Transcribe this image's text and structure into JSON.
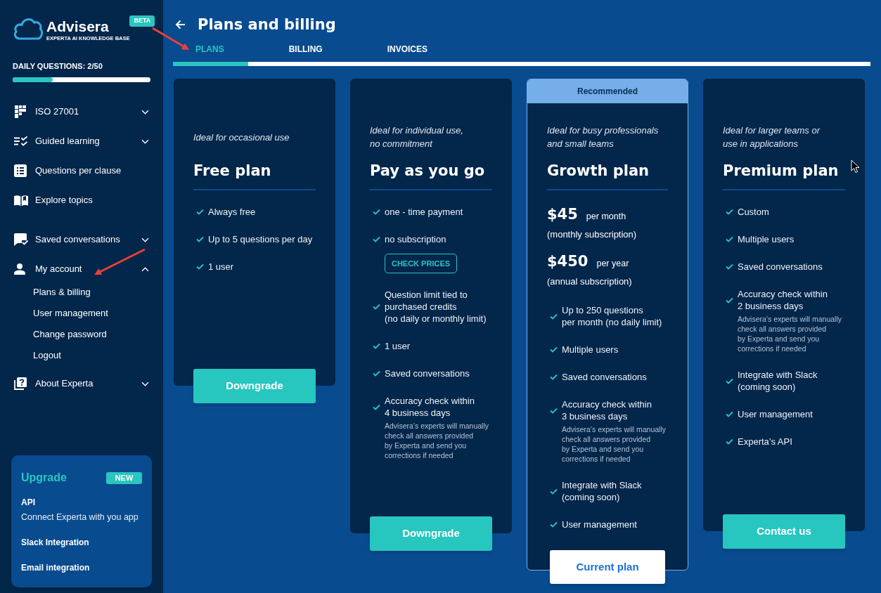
{
  "sidebar": {
    "brand": {
      "name": "Advisera",
      "subtitle": "EXPERTA AI KNOWLEDGE BASE",
      "badge": "BETA"
    },
    "daily_questions": {
      "label": "DAILY QUESTIONS: 2/50",
      "level": 0.29
    },
    "nav_groups": [
      {
        "items": [
          {
            "label": "ISO 27001",
            "expanded": false
          },
          {
            "label": "Guided learning",
            "expanded": false
          },
          {
            "label": "Questions per clause"
          },
          {
            "label": "Explore topics"
          }
        ]
      },
      {
        "items": [
          {
            "label": "Saved conversations",
            "expanded": false
          },
          {
            "label": "My account",
            "expanded": true,
            "children": [
              {
                "label": "Plans & billing"
              },
              {
                "label": "User management"
              },
              {
                "label": "Change password"
              },
              {
                "label": "Logout"
              }
            ]
          },
          {
            "label": "About Experta",
            "expanded": false
          }
        ]
      }
    ],
    "upgrade": {
      "title": "Upgrade",
      "badge": "NEW",
      "items": [
        {
          "title": "API",
          "description": "Connect Experta with you app"
        },
        {
          "title": "Slack Integration"
        },
        {
          "title": "Email integration"
        }
      ]
    }
  },
  "header": {
    "title": "Plans and billing",
    "tabs": [
      {
        "label": "PLANS",
        "selected": true
      },
      {
        "label": "BILLING",
        "selected": false
      },
      {
        "label": "INVOICES",
        "selected": false
      }
    ]
  },
  "plans": [
    {
      "tagline": "Ideal for occasional use",
      "name": "Free plan",
      "features": [
        {
          "text": "Always free"
        },
        {
          "text": "Up to 5 questions per day"
        },
        {
          "text": "1 user"
        }
      ],
      "button": {
        "label": "Downgrade",
        "kind": "primary"
      }
    },
    {
      "tagline": "Ideal for individual use,\nno commitment",
      "name": "Pay as you go",
      "features": [
        {
          "text": "one - time payment"
        },
        {
          "text": "no subscription",
          "button": "CHECK PRICES"
        },
        {
          "text": "Question limit tied to\npurchased credits\n(no daily or monthly limit)"
        },
        {
          "text": "1 user"
        },
        {
          "text": "Saved conversations"
        },
        {
          "text": "Accuracy check within\n4 business days",
          "note": "Advisera’s experts will manually\ncheck all answers provided\nby Experta and send you\ncorrections if needed"
        }
      ],
      "button": {
        "label": "Downgrade",
        "kind": "primary"
      }
    },
    {
      "badge": "Recommended",
      "tagline": "Ideal for busy professionals\nand small teams",
      "name": "Growth plan",
      "prices": [
        {
          "amount": "$45",
          "period": "per month",
          "note": "(monthly subscription)"
        },
        {
          "amount": "$450",
          "period": "per year",
          "note": "(annual subscription)"
        }
      ],
      "features": [
        {
          "text": "Up to 250 questions\nper month (no daily limit)"
        },
        {
          "text": "Multiple users"
        },
        {
          "text": "Saved conversations"
        },
        {
          "text": "Accuracy check within\n3 business days",
          "note": "Advisera’s experts will manually\ncheck all answers provided\nby Experta and send you\ncorrections if needed"
        },
        {
          "text": "Integrate with Slack\n(coming soon)"
        },
        {
          "text": "User management"
        }
      ],
      "button": {
        "label": "Current plan",
        "kind": "current"
      }
    },
    {
      "tagline": "Ideal for larger teams or\nuse in applications",
      "name": "Premium plan",
      "features": [
        {
          "text": "Custom"
        },
        {
          "text": "Multiple users"
        },
        {
          "text": "Saved conversations"
        },
        {
          "text": "Accuracy check within\n2 business days",
          "note": "Advisera’s experts will manually\ncheck all answers provided\nby Experta and send you\ncorrections if needed"
        },
        {
          "text": "Integrate with Slack\n(coming soon)"
        },
        {
          "text": "User management"
        },
        {
          "text": "Experta’s API"
        }
      ],
      "button": {
        "label": "Contact us",
        "kind": "primary"
      }
    }
  ]
}
